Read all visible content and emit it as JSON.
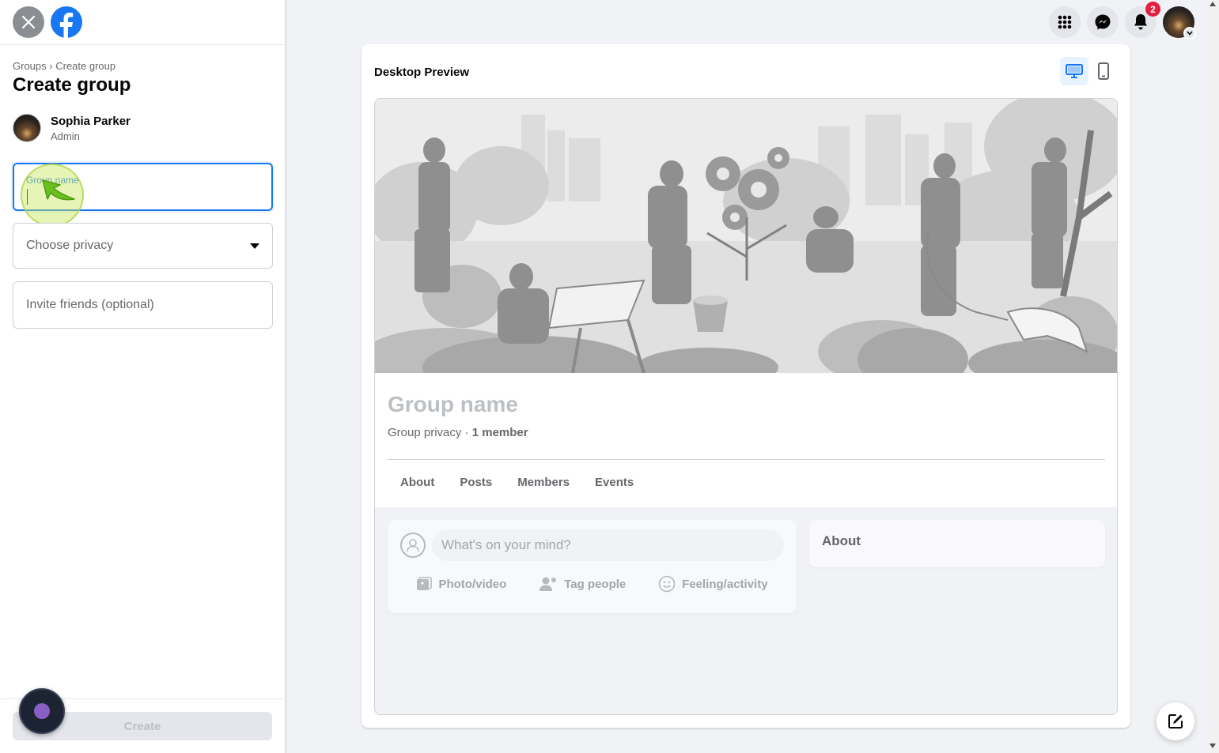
{
  "sidebar": {
    "breadcrumb_root": "Groups",
    "breadcrumb_sep": "›",
    "breadcrumb_current": "Create group",
    "title": "Create group",
    "admin": {
      "name": "Sophia Parker",
      "role": "Admin"
    },
    "group_name_label": "Group name",
    "group_name_value": "",
    "privacy_placeholder": "Choose privacy",
    "invite_placeholder": "Invite friends (optional)",
    "create_label": "Create"
  },
  "nav": {
    "notification_count": "2"
  },
  "preview": {
    "title": "Desktop Preview",
    "group_name": "Group name",
    "group_privacy": "Group privacy",
    "meta_sep": " · ",
    "member_count": "1 member",
    "tabs": [
      "About",
      "Posts",
      "Members",
      "Events"
    ],
    "composer_placeholder": "What's on your mind?",
    "composer_actions": [
      "Photo/video",
      "Tag people",
      "Feeling/activity"
    ],
    "about_title": "About"
  },
  "colors": {
    "brand": "#1877f2",
    "badge": "#e41e3f",
    "click_marker": "#c8e65a"
  },
  "icons": [
    "close-icon",
    "facebook-logo",
    "menu-grid-icon",
    "messenger-icon",
    "bell-icon",
    "desktop-icon",
    "mobile-icon",
    "user-icon",
    "photo-icon",
    "tag-icon",
    "smile-icon",
    "compose-icon",
    "chevron-down-icon"
  ]
}
